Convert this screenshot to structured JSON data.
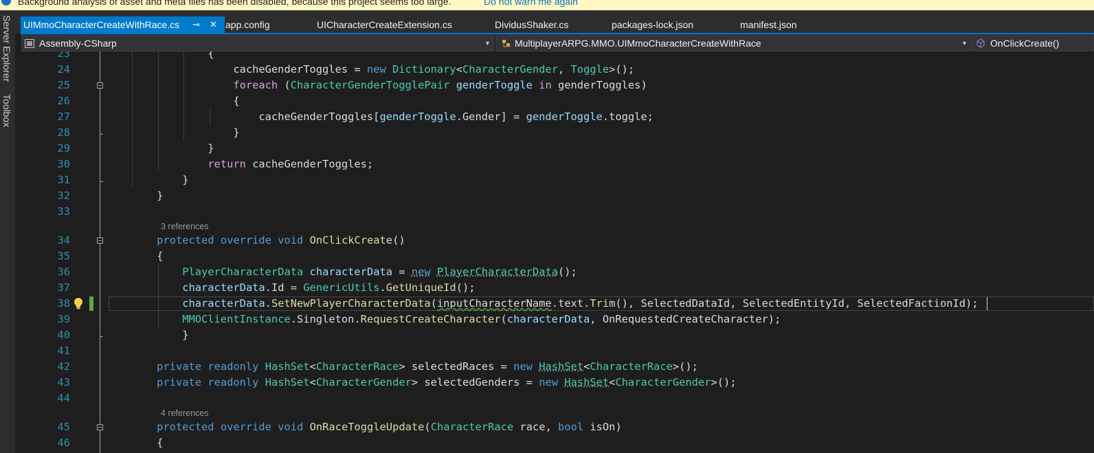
{
  "info_bar": {
    "message": "Background analysis of asset and meta files has been disabled, because this project seems too large.",
    "link": "Do not warn me again"
  },
  "left_tool_windows": [
    "Server Explorer",
    "Toolbox"
  ],
  "tabs": [
    {
      "label": "UIMmoCharacterCreateWithRace.cs",
      "active": true,
      "pin_icon": "⊸",
      "close_icon": "✕"
    },
    {
      "label": "app.config",
      "active": false
    },
    {
      "label": "UICharacterCreateExtension.cs",
      "active": false
    },
    {
      "label": "DividusShaker.cs",
      "active": false
    },
    {
      "label": "packages-lock.json",
      "active": false
    },
    {
      "label": "manifest.json",
      "active": false
    }
  ],
  "nav": {
    "project": "Assembly-CSharp",
    "type": "MultiplayerARPG.MMO.UIMmoCharacterCreateWithRace",
    "member": "OnClickCreate()"
  },
  "colors": {
    "accent": "#007acc",
    "keyword": "#569cd6",
    "control_keyword": "#d8a0df",
    "type": "#4ec9b0",
    "method": "#dcdcaa",
    "variable": "#9cdcfe",
    "plain": "#dcdcdc",
    "line_number": "#2b91af",
    "codelens": "#999999",
    "change_marker": "#57a64a",
    "info_bar_bg": "#fff8c4"
  },
  "editor": {
    "current_line": "38",
    "lines": [
      {
        "n": "23",
        "tokens": [
          {
            "t": "                {",
            "c": "pl"
          }
        ]
      },
      {
        "n": "24",
        "tokens": [
          {
            "t": "                    cacheGenderToggles ",
            "c": "pl"
          },
          {
            "t": "= ",
            "c": "pl"
          },
          {
            "t": "new",
            "c": "kw"
          },
          {
            "t": " ",
            "c": "pl"
          },
          {
            "t": "Dictionary",
            "c": "ty"
          },
          {
            "t": "<",
            "c": "pl"
          },
          {
            "t": "CharacterGender",
            "c": "ty"
          },
          {
            "t": ", ",
            "c": "pl"
          },
          {
            "t": "Toggle",
            "c": "ty"
          },
          {
            "t": ">();",
            "c": "pl"
          }
        ]
      },
      {
        "n": "25",
        "tokens": [
          {
            "t": "                    ",
            "c": "pl"
          },
          {
            "t": "foreach",
            "c": "ctl"
          },
          {
            "t": " (",
            "c": "pl"
          },
          {
            "t": "CharacterGenderTogglePair",
            "c": "ty"
          },
          {
            "t": " ",
            "c": "pl"
          },
          {
            "t": "genderToggle",
            "c": "pr"
          },
          {
            "t": " ",
            "c": "pl"
          },
          {
            "t": "in",
            "c": "ctl"
          },
          {
            "t": " genderToggles)",
            "c": "pl"
          }
        ]
      },
      {
        "n": "26",
        "tokens": [
          {
            "t": "                    {",
            "c": "pl"
          }
        ]
      },
      {
        "n": "27",
        "tokens": [
          {
            "t": "                        cacheGenderToggles[",
            "c": "pl"
          },
          {
            "t": "genderToggle",
            "c": "pr"
          },
          {
            "t": ".Gender] = ",
            "c": "pl"
          },
          {
            "t": "genderToggle",
            "c": "pr"
          },
          {
            "t": ".toggle;",
            "c": "pl"
          }
        ]
      },
      {
        "n": "28",
        "tokens": [
          {
            "t": "                    }",
            "c": "pl"
          }
        ]
      },
      {
        "n": "29",
        "tokens": [
          {
            "t": "                }",
            "c": "pl"
          }
        ]
      },
      {
        "n": "30",
        "tokens": [
          {
            "t": "                ",
            "c": "pl"
          },
          {
            "t": "return",
            "c": "ctl"
          },
          {
            "t": " cacheGenderToggles;",
            "c": "pl"
          }
        ]
      },
      {
        "n": "31",
        "tokens": [
          {
            "t": "            }",
            "c": "pl"
          }
        ]
      },
      {
        "n": "32",
        "tokens": [
          {
            "t": "        }",
            "c": "pl"
          }
        ]
      },
      {
        "n": "33",
        "tokens": []
      },
      {
        "codelens": "3 references"
      },
      {
        "n": "34",
        "tokens": [
          {
            "t": "        ",
            "c": "pl"
          },
          {
            "t": "protected",
            "c": "kw"
          },
          {
            "t": " ",
            "c": "pl"
          },
          {
            "t": "override",
            "c": "kw"
          },
          {
            "t": " ",
            "c": "pl"
          },
          {
            "t": "void",
            "c": "kw"
          },
          {
            "t": " ",
            "c": "pl"
          },
          {
            "t": "OnClickCreate",
            "c": "fn"
          },
          {
            "t": "()",
            "c": "pl"
          }
        ]
      },
      {
        "n": "35",
        "tokens": [
          {
            "t": "        {",
            "c": "pl"
          }
        ]
      },
      {
        "n": "36",
        "tokens": [
          {
            "t": "            ",
            "c": "pl"
          },
          {
            "t": "PlayerCharacterData",
            "c": "ty"
          },
          {
            "t": " ",
            "c": "pl"
          },
          {
            "t": "characterData",
            "c": "pr"
          },
          {
            "t": " = ",
            "c": "pl"
          },
          {
            "t": "new",
            "c": "kw",
            "u": "dot"
          },
          {
            "t": " ",
            "c": "pl"
          },
          {
            "t": "PlayerCharacterData",
            "c": "ty",
            "u": "dot"
          },
          {
            "t": "();",
            "c": "pl"
          }
        ]
      },
      {
        "n": "37",
        "tokens": [
          {
            "t": "            ",
            "c": "pl"
          },
          {
            "t": "characterData",
            "c": "pr"
          },
          {
            "t": ".Id = ",
            "c": "pl"
          },
          {
            "t": "GenericUtils",
            "c": "ty"
          },
          {
            "t": ".",
            "c": "pl"
          },
          {
            "t": "GetUniqueId",
            "c": "fn"
          },
          {
            "t": "();",
            "c": "pl"
          }
        ]
      },
      {
        "n": "38",
        "tokens": [
          {
            "t": "            ",
            "c": "pl"
          },
          {
            "t": "characterData",
            "c": "pr"
          },
          {
            "t": ".",
            "c": "pl"
          },
          {
            "t": "SetNewPlayerCharacterData",
            "c": "fn"
          },
          {
            "t": "(",
            "c": "pl"
          },
          {
            "t": "inputCharacterName",
            "c": "pl",
            "u": "wavy"
          },
          {
            "t": ".text.",
            "c": "pl"
          },
          {
            "t": "Trim",
            "c": "fn"
          },
          {
            "t": "(), SelectedDataId, SelectedEntityId, SelectedFactionId);",
            "c": "pl"
          }
        ]
      },
      {
        "n": "39",
        "tokens": [
          {
            "t": "            ",
            "c": "pl"
          },
          {
            "t": "MMOClientInstance",
            "c": "ty"
          },
          {
            "t": ".Singleton.",
            "c": "pl"
          },
          {
            "t": "RequestCreateCharacter",
            "c": "fn"
          },
          {
            "t": "(",
            "c": "pl"
          },
          {
            "t": "characterData",
            "c": "pr"
          },
          {
            "t": ", OnRequestedCreateCharacter);",
            "c": "pl"
          }
        ]
      },
      {
        "n": "40",
        "tokens": [
          {
            "t": "            }",
            "c": "pl"
          }
        ]
      },
      {
        "n": "41",
        "tokens": []
      },
      {
        "n": "42",
        "tokens": [
          {
            "t": "        ",
            "c": "pl"
          },
          {
            "t": "private",
            "c": "kw"
          },
          {
            "t": " ",
            "c": "pl"
          },
          {
            "t": "readonly",
            "c": "kw"
          },
          {
            "t": " ",
            "c": "pl"
          },
          {
            "t": "HashSet",
            "c": "ty"
          },
          {
            "t": "<",
            "c": "pl"
          },
          {
            "t": "CharacterRace",
            "c": "ty"
          },
          {
            "t": "> selectedRaces = ",
            "c": "pl"
          },
          {
            "t": "new",
            "c": "kw"
          },
          {
            "t": " ",
            "c": "pl"
          },
          {
            "t": "HashSet",
            "c": "ty",
            "u": "dot"
          },
          {
            "t": "<",
            "c": "pl"
          },
          {
            "t": "CharacterRace",
            "c": "ty"
          },
          {
            "t": ">();",
            "c": "pl"
          }
        ]
      },
      {
        "n": "43",
        "tokens": [
          {
            "t": "        ",
            "c": "pl"
          },
          {
            "t": "private",
            "c": "kw"
          },
          {
            "t": " ",
            "c": "pl"
          },
          {
            "t": "readonly",
            "c": "kw"
          },
          {
            "t": " ",
            "c": "pl"
          },
          {
            "t": "HashSet",
            "c": "ty"
          },
          {
            "t": "<",
            "c": "pl"
          },
          {
            "t": "CharacterGender",
            "c": "ty"
          },
          {
            "t": "> selectedGenders = ",
            "c": "pl"
          },
          {
            "t": "new",
            "c": "kw"
          },
          {
            "t": " ",
            "c": "pl"
          },
          {
            "t": "HashSet",
            "c": "ty",
            "u": "dot"
          },
          {
            "t": "<",
            "c": "pl"
          },
          {
            "t": "CharacterGender",
            "c": "ty"
          },
          {
            "t": ">();",
            "c": "pl"
          }
        ]
      },
      {
        "n": "44",
        "tokens": []
      },
      {
        "codelens": "4 references"
      },
      {
        "n": "45",
        "tokens": [
          {
            "t": "        ",
            "c": "pl"
          },
          {
            "t": "protected",
            "c": "kw"
          },
          {
            "t": " ",
            "c": "pl"
          },
          {
            "t": "override",
            "c": "kw"
          },
          {
            "t": " ",
            "c": "pl"
          },
          {
            "t": "void",
            "c": "kw"
          },
          {
            "t": " ",
            "c": "pl"
          },
          {
            "t": "OnRaceToggleUpdate",
            "c": "fn"
          },
          {
            "t": "(",
            "c": "pl"
          },
          {
            "t": "CharacterRace",
            "c": "ty"
          },
          {
            "t": " race, ",
            "c": "pl"
          },
          {
            "t": "bool",
            "c": "kw"
          },
          {
            "t": " isOn)",
            "c": "pl"
          }
        ]
      },
      {
        "n": "46",
        "tokens": [
          {
            "t": "        {",
            "c": "pl"
          }
        ]
      }
    ]
  }
}
